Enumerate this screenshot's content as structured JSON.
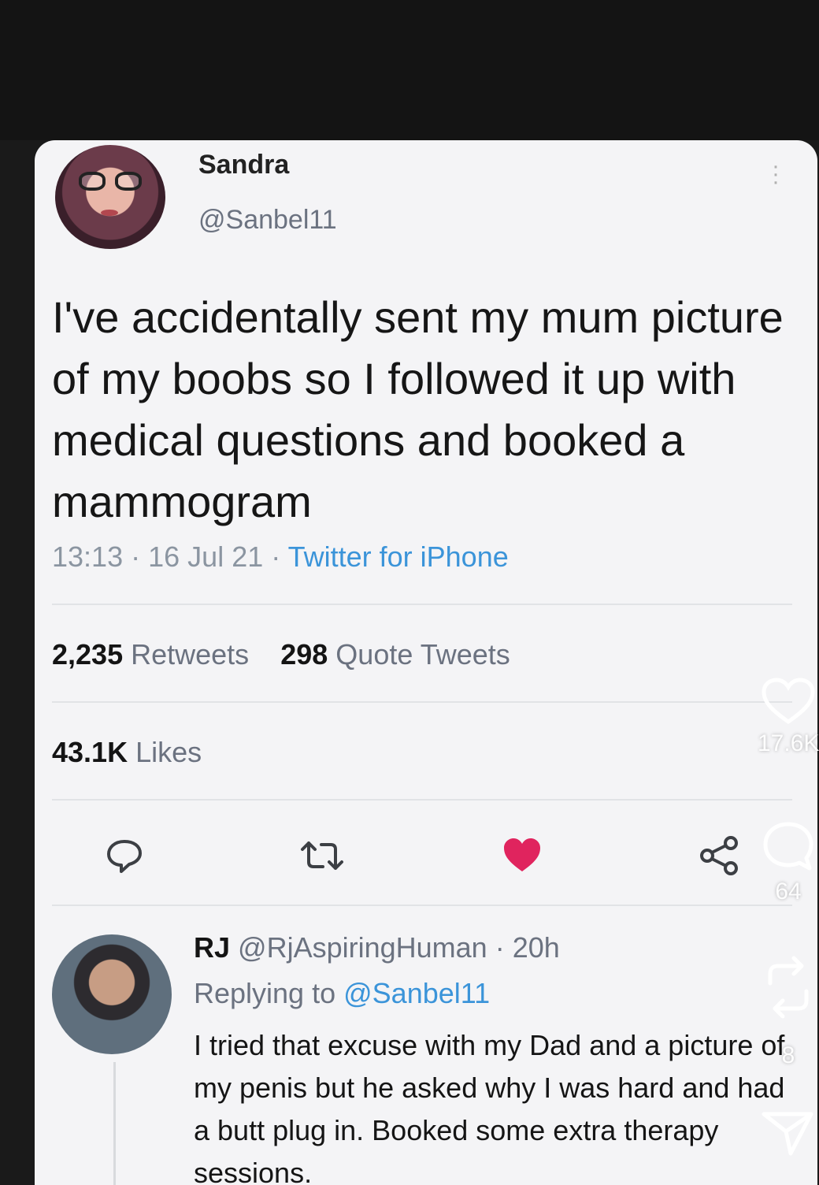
{
  "tweet": {
    "name": "Sandra",
    "handle": "@Sanbel11",
    "text": "I've accidentally sent my mum picture of my boobs so I followed it up with medical questions and booked a mammogram",
    "time": "13:13",
    "date": "16 Jul 21",
    "source": "Twitter for iPhone",
    "sep": "·",
    "retweets_count": "2,235",
    "retweets_label": "Retweets",
    "quotes_count": "298",
    "quotes_label": "Quote Tweets",
    "likes_count": "43.1K",
    "likes_label": "Likes"
  },
  "reply": {
    "name": "RJ",
    "handle": "@RjAspiringHuman",
    "age": "20h",
    "sep": "·",
    "replying_prefix": "Replying to",
    "replying_handle": "@Sanbel11",
    "text": "I tried that excuse with my Dad and a picture of my penis but he asked why I was hard and had a butt plug in. Booked some extra therapy sessions."
  },
  "overlay": {
    "likes": "17.6K",
    "comments": "64",
    "reposts": "8"
  },
  "icons": {
    "reply": "speech-bubble-icon",
    "retweet": "retweet-icon",
    "like": "heart-filled-icon",
    "share": "share-icon",
    "overlay_like": "heart-outline-icon",
    "overlay_comment": "comment-icon",
    "overlay_repost": "repost-icon",
    "overlay_send": "send-icon"
  },
  "colors": {
    "like_red": "#e0245e",
    "link_blue": "#3b94d9"
  }
}
